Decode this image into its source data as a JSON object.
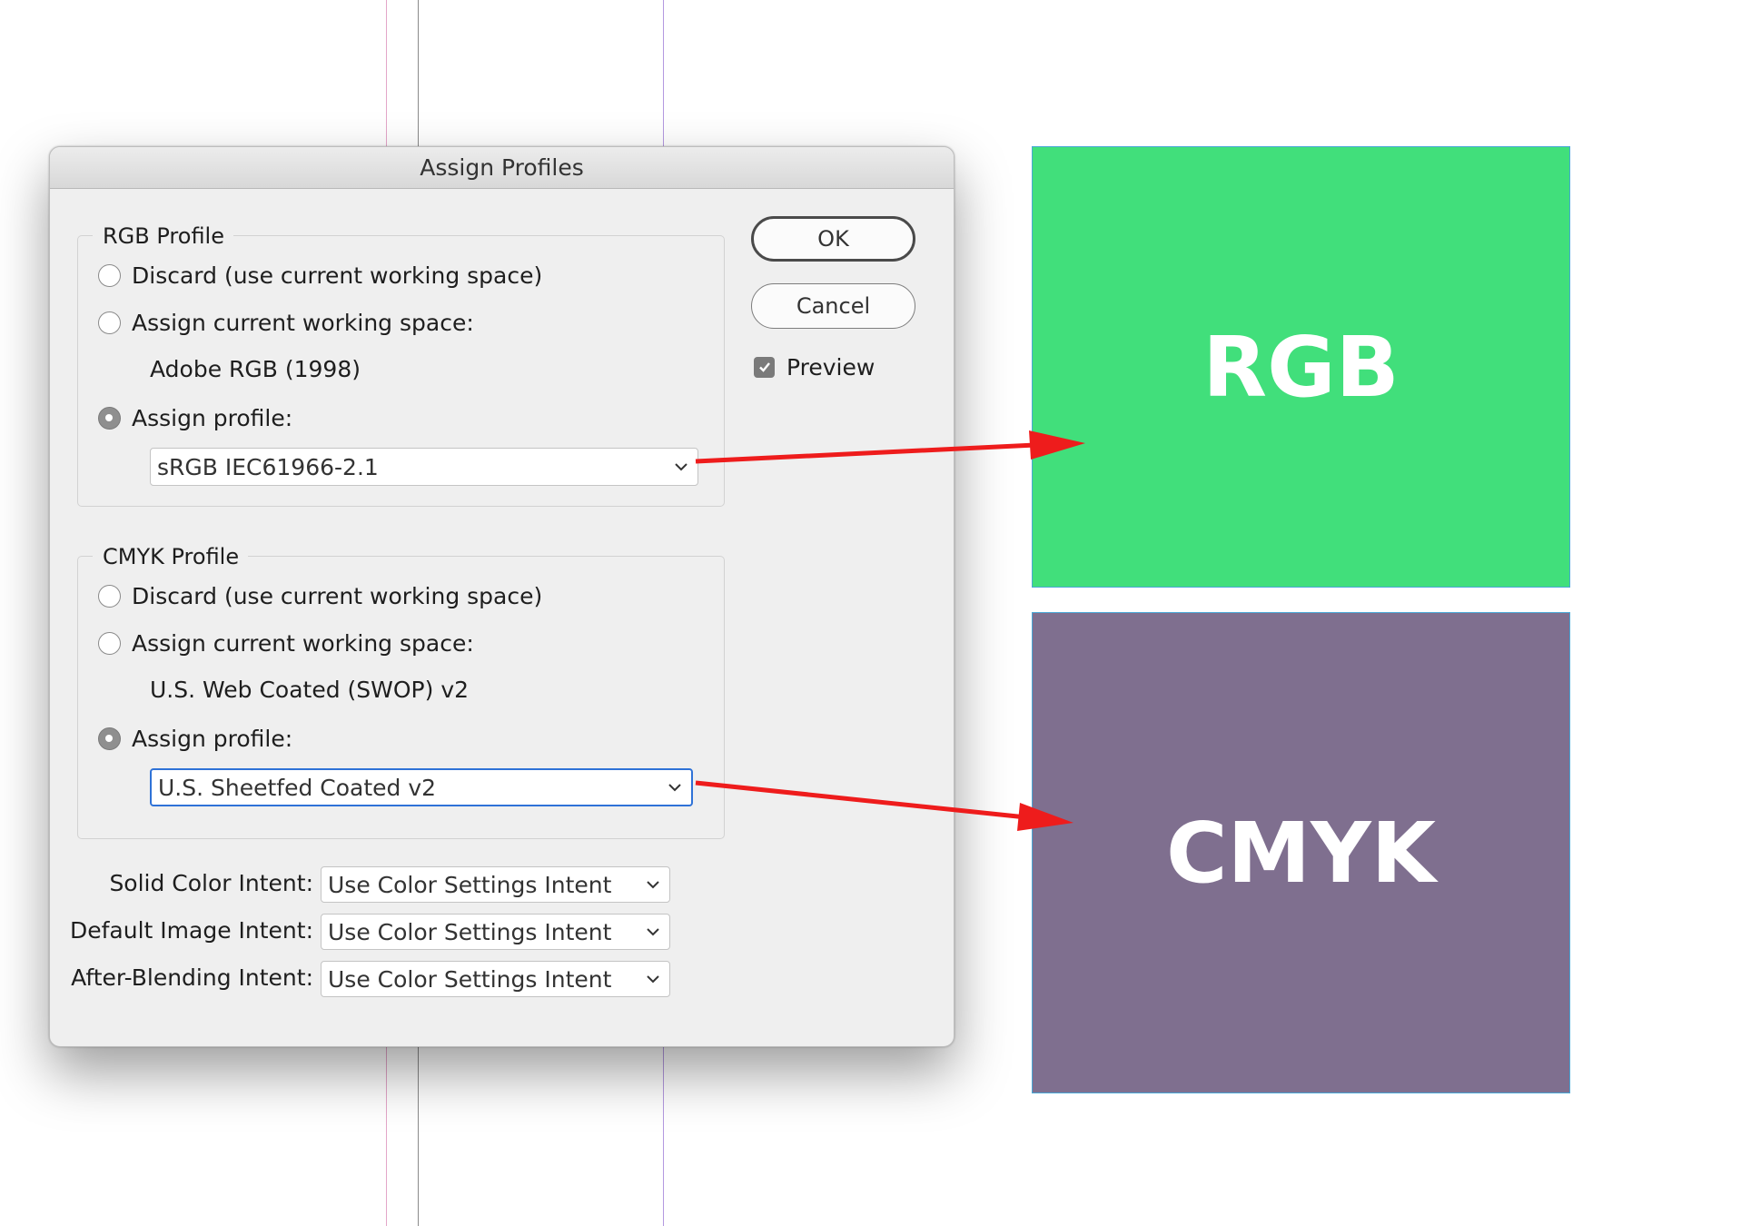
{
  "dialog": {
    "title": "Assign Profiles",
    "rgb_profile": {
      "legend": "RGB Profile",
      "discard_label": "Discard (use current working space)",
      "assign_current_label": "Assign current working space:",
      "current_space": "Adobe RGB (1998)",
      "assign_profile_label": "Assign profile:",
      "selected_profile": "sRGB IEC61966-2.1",
      "selected_option": "assign_profile"
    },
    "cmyk_profile": {
      "legend": "CMYK Profile",
      "discard_label": "Discard (use current working space)",
      "assign_current_label": "Assign current working space:",
      "current_space": "U.S. Web Coated (SWOP) v2",
      "assign_profile_label": "Assign profile:",
      "selected_profile": "U.S. Sheetfed Coated v2",
      "selected_option": "assign_profile"
    },
    "intents": {
      "solid_label": "Solid Color Intent:",
      "solid_value": "Use Color Settings Intent",
      "image_label": "Default Image Intent:",
      "image_value": "Use Color Settings Intent",
      "blending_label": "After-Blending Intent:",
      "blending_value": "Use Color Settings Intent"
    },
    "buttons": {
      "ok": "OK",
      "cancel": "Cancel"
    },
    "preview": {
      "label": "Preview",
      "checked": true
    }
  },
  "swatches": {
    "rgb": {
      "label": "RGB",
      "color": "#41df7b"
    },
    "cmyk": {
      "label": "CMYK",
      "color": "#7f6f8f"
    }
  },
  "colors": {
    "arrow": "#ee1c1c",
    "focus": "#2f72d7"
  }
}
